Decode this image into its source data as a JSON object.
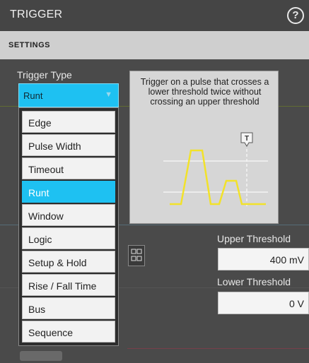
{
  "header": {
    "title": "TRIGGER",
    "help_icon": "help-circle-icon"
  },
  "subbar": {
    "label": "SETTINGS"
  },
  "trigger_type": {
    "label": "Trigger Type",
    "selected": "Runt",
    "options": [
      "Edge",
      "Pulse Width",
      "Timeout",
      "Runt",
      "Window",
      "Logic",
      "Setup & Hold",
      "Rise / Fall Time",
      "Bus",
      "Sequence"
    ],
    "active_index": 3
  },
  "description": {
    "text": "Trigger on a pulse that crosses a lower threshold twice without crossing an upper threshold",
    "marker": "T"
  },
  "upper_threshold": {
    "label": "Upper Threshold",
    "value": "400 mV"
  },
  "lower_threshold": {
    "label": "Lower Threshold",
    "value": "0 V"
  },
  "colors": {
    "accent": "#1ec1f2",
    "signal": "#f2e22a"
  }
}
